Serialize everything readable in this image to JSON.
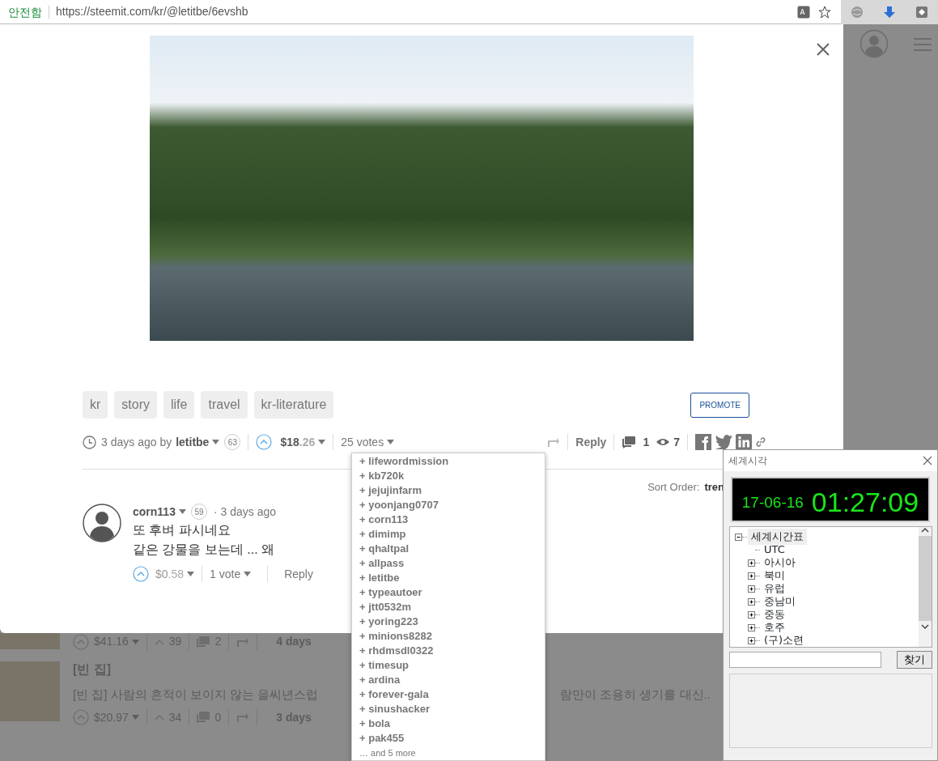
{
  "browser": {
    "security_label": "안전함",
    "url": "https://steemit.com/kr/@letitbe/6evshb"
  },
  "post": {
    "tags": [
      "kr",
      "story",
      "life",
      "travel",
      "kr-literature"
    ],
    "promote": "PROMOTE",
    "time": "3 days ago by",
    "author": "letitbe",
    "reputation": "63",
    "payout": {
      "whole": "$18",
      "fraction": ".26"
    },
    "votes": "25 votes",
    "reply": "Reply",
    "comments": "1",
    "views": "7"
  },
  "voters": {
    "items": [
      "+ lifewordmission",
      "+ kb720k",
      "+ jejujinfarm",
      "+ yoonjang0707",
      "+ corn113",
      "+ dimimp",
      "+ qhaltpal",
      "+ allpass",
      "+ letitbe",
      "+ typeautoer",
      "+ jtt0532m",
      "+ yoring223",
      "+ minions8282",
      "+ rhdmsdl0322",
      "+ timesup",
      "+ ardina",
      "+ forever-gala",
      "+ sinushacker",
      "+ bola",
      "+ pak455"
    ],
    "more": "… and 5 more"
  },
  "sort": {
    "label": "Sort Order:",
    "value": "tren"
  },
  "comments": [
    {
      "author": "corn113",
      "reputation": "59",
      "time": "· 3 days ago",
      "lines": [
        "또 후벼 파시네요",
        "같은 강물을 보는데 ... 왜"
      ],
      "payout": {
        "whole": "$0",
        "fraction": ".58"
      },
      "votes": "1 vote",
      "reply": "Reply"
    }
  ],
  "feed": [
    {
      "payout": "$41.16",
      "votes": "39",
      "comments": "2",
      "age": "4 days"
    },
    {
      "title": "[빈 집]",
      "excerpt_start": "[빈 집] 사람의 흔적이 보이지 않는 을씨년스럽",
      "excerpt_end": "람만이 조용히 생기를 대신..",
      "payout": "$20.97",
      "votes": "34",
      "comments": "0",
      "age": "3 days"
    }
  ],
  "clock": {
    "title": "세계시각",
    "date": "17-06-16",
    "time": "01:27:09",
    "search_button": "찾기",
    "tree": [
      {
        "label": "세계시간표",
        "kind": "folder",
        "expanded": true,
        "selected": true,
        "children": [
          {
            "label": "UTC",
            "kind": "leaf",
            "selected": false
          },
          {
            "label": "아시아",
            "kind": "folder",
            "expanded": false,
            "selected": false
          },
          {
            "label": "북미",
            "kind": "folder",
            "expanded": false,
            "selected": false
          },
          {
            "label": "유럽",
            "kind": "folder",
            "expanded": false,
            "selected": false
          },
          {
            "label": "중남미",
            "kind": "folder",
            "expanded": false,
            "selected": false
          },
          {
            "label": "중동",
            "kind": "folder",
            "expanded": false,
            "selected": false
          },
          {
            "label": "호주",
            "kind": "folder",
            "expanded": false,
            "selected": false
          },
          {
            "label": "(구)소련",
            "kind": "folder",
            "expanded": false,
            "selected": false
          }
        ]
      }
    ]
  }
}
